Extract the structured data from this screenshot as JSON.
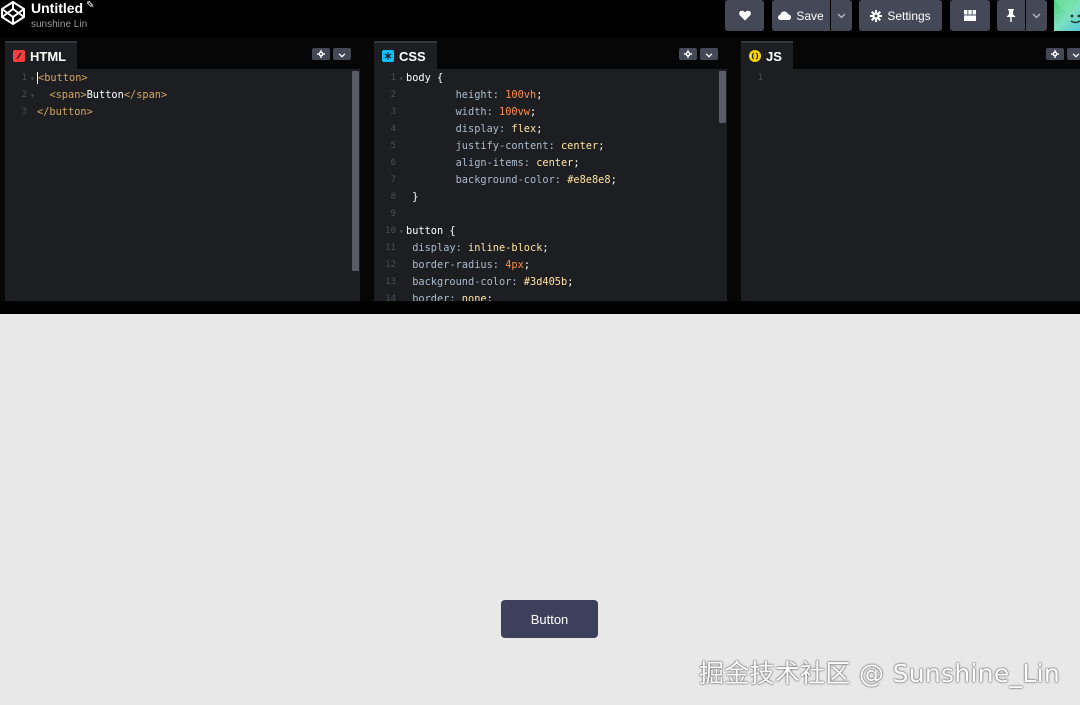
{
  "header": {
    "title": "Untitled",
    "author": "sunshine Lin",
    "save_label": "Save",
    "settings_label": "Settings"
  },
  "panels": {
    "html": {
      "label": "HTML",
      "lines": [
        {
          "n": "1",
          "fold": "▾",
          "parts": [
            {
              "c": "tag",
              "t": "<button>"
            }
          ]
        },
        {
          "n": "2",
          "fold": "▾",
          "parts": [
            {
              "c": "tag",
              "t": "  <span>"
            },
            {
              "c": "plain",
              "t": "Button"
            },
            {
              "c": "tag",
              "t": "</span>"
            }
          ]
        },
        {
          "n": "3",
          "fold": "",
          "parts": [
            {
              "c": "tag",
              "t": "</button>"
            }
          ]
        }
      ]
    },
    "css": {
      "label": "CSS",
      "lines": [
        {
          "n": "1",
          "fold": "▾",
          "parts": [
            {
              "c": "sel",
              "t": "body {"
            }
          ]
        },
        {
          "n": "2",
          "fold": "",
          "parts": [
            {
              "c": "prop",
              "t": "        height: "
            },
            {
              "c": "val",
              "t": "100vh"
            },
            {
              "c": "plain",
              "t": ";"
            }
          ]
        },
        {
          "n": "3",
          "fold": "",
          "parts": [
            {
              "c": "prop",
              "t": "        width: "
            },
            {
              "c": "val",
              "t": "100vw"
            },
            {
              "c": "plain",
              "t": ";"
            }
          ]
        },
        {
          "n": "4",
          "fold": "",
          "parts": [
            {
              "c": "prop",
              "t": "        display: "
            },
            {
              "c": "kw",
              "t": "flex"
            },
            {
              "c": "plain",
              "t": ";"
            }
          ]
        },
        {
          "n": "5",
          "fold": "",
          "parts": [
            {
              "c": "prop",
              "t": "        justify-content: "
            },
            {
              "c": "kw",
              "t": "center"
            },
            {
              "c": "plain",
              "t": ";"
            }
          ]
        },
        {
          "n": "6",
          "fold": "",
          "parts": [
            {
              "c": "prop",
              "t": "        align-items: "
            },
            {
              "c": "kw",
              "t": "center"
            },
            {
              "c": "plain",
              "t": ";"
            }
          ]
        },
        {
          "n": "7",
          "fold": "",
          "parts": [
            {
              "c": "prop",
              "t": "        background-color: "
            },
            {
              "c": "hex",
              "t": "#e8e8e8"
            },
            {
              "c": "plain",
              "t": ";"
            }
          ]
        },
        {
          "n": "8",
          "fold": "",
          "parts": [
            {
              "c": "sel",
              "t": " }"
            }
          ]
        },
        {
          "n": "9",
          "fold": "",
          "parts": []
        },
        {
          "n": "10",
          "fold": "▾",
          "parts": [
            {
              "c": "sel",
              "t": "button {"
            }
          ]
        },
        {
          "n": "11",
          "fold": "",
          "parts": [
            {
              "c": "prop",
              "t": " display: "
            },
            {
              "c": "kw",
              "t": "inline-block"
            },
            {
              "c": "plain",
              "t": ";"
            }
          ]
        },
        {
          "n": "12",
          "fold": "",
          "parts": [
            {
              "c": "prop",
              "t": " border-radius: "
            },
            {
              "c": "val",
              "t": "4px"
            },
            {
              "c": "plain",
              "t": ";"
            }
          ]
        },
        {
          "n": "13",
          "fold": "",
          "parts": [
            {
              "c": "prop",
              "t": " background-color: "
            },
            {
              "c": "hex",
              "t": "#3d405b"
            },
            {
              "c": "plain",
              "t": ";"
            }
          ]
        },
        {
          "n": "14",
          "fold": "",
          "parts": [
            {
              "c": "prop",
              "t": " border: "
            },
            {
              "c": "kw",
              "t": "none"
            },
            {
              "c": "plain",
              "t": ";"
            }
          ]
        }
      ]
    },
    "js": {
      "label": "JS",
      "lines": [
        {
          "n": "1",
          "fold": "",
          "parts": []
        }
      ]
    }
  },
  "preview": {
    "button_label": "Button",
    "watermark": "掘金技术社区 @ Sunshine_Lin"
  },
  "icons": {
    "logo": "codepen-logo-icon",
    "heart": "heart-icon",
    "save": "cloud-icon",
    "settings": "gear-icon",
    "layout": "layout-grid-icon",
    "pin": "pin-icon"
  },
  "colors": {
    "topbar_bg": "#000000",
    "button_bg": "#444857",
    "editor_bg": "#1d1e22",
    "preview_bg": "#e8e8e8",
    "demo_button": "#3d405b",
    "html_icon": "#ff3c41",
    "css_icon": "#0ebeff",
    "js_icon": "#fcd000"
  }
}
